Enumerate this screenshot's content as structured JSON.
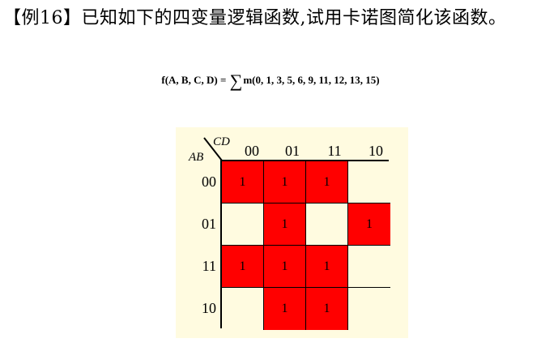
{
  "problem": {
    "text": "【例16】已知如下的四变量逻辑函数,试用卡诺图简化该函数。"
  },
  "formula": {
    "lhs": "f(A, B, C, D) = ",
    "sigma": "∑",
    "rhs": "m(0, 1, 3, 5, 6, 9, 11, 12, 13, 15)"
  },
  "kmap": {
    "row_var": "AB",
    "col_var": "CD",
    "col_labels": [
      "00",
      "01",
      "11",
      "10"
    ],
    "row_labels": [
      "00",
      "01",
      "11",
      "10"
    ],
    "cells": [
      [
        "1",
        "1",
        "1",
        ""
      ],
      [
        "",
        "1",
        "",
        "1"
      ],
      [
        "1",
        "1",
        "1",
        ""
      ],
      [
        "",
        "1",
        "1",
        ""
      ]
    ],
    "colors": {
      "one_fill": "#ff0000",
      "empty_fill": "#fffbe0",
      "panel": "#fffbe0"
    }
  }
}
